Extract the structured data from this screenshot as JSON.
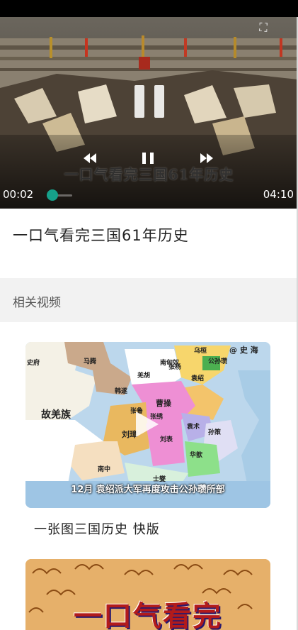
{
  "player": {
    "subtitle": "一口气看完三国61年历史",
    "current_time": "00:02",
    "total_time": "04:10",
    "progress": 0.008,
    "accent_color": "#16a08a"
  },
  "video": {
    "title": "一口气看完三国61年历史"
  },
  "related": {
    "header": "相关视频",
    "items": [
      {
        "title": "一张图三国历史 快版",
        "map_caption": "12月 袁绍派大军再度攻击公孙瓒所部",
        "map_labels": [
          "马腾",
          "乌桓",
          "@ 史 海",
          "史府",
          "羌胡",
          "南匈奴",
          "公孙瓒",
          "张杨",
          "韩遂",
          "袁绍",
          "曹操",
          "故羌族",
          "张鲁",
          "张绣",
          "刘璋",
          "刘表",
          "袁术",
          "孙策",
          "华歆",
          "南中",
          "士燮"
        ]
      },
      {
        "title": "",
        "thumb_text": "一口气看完"
      }
    ]
  }
}
